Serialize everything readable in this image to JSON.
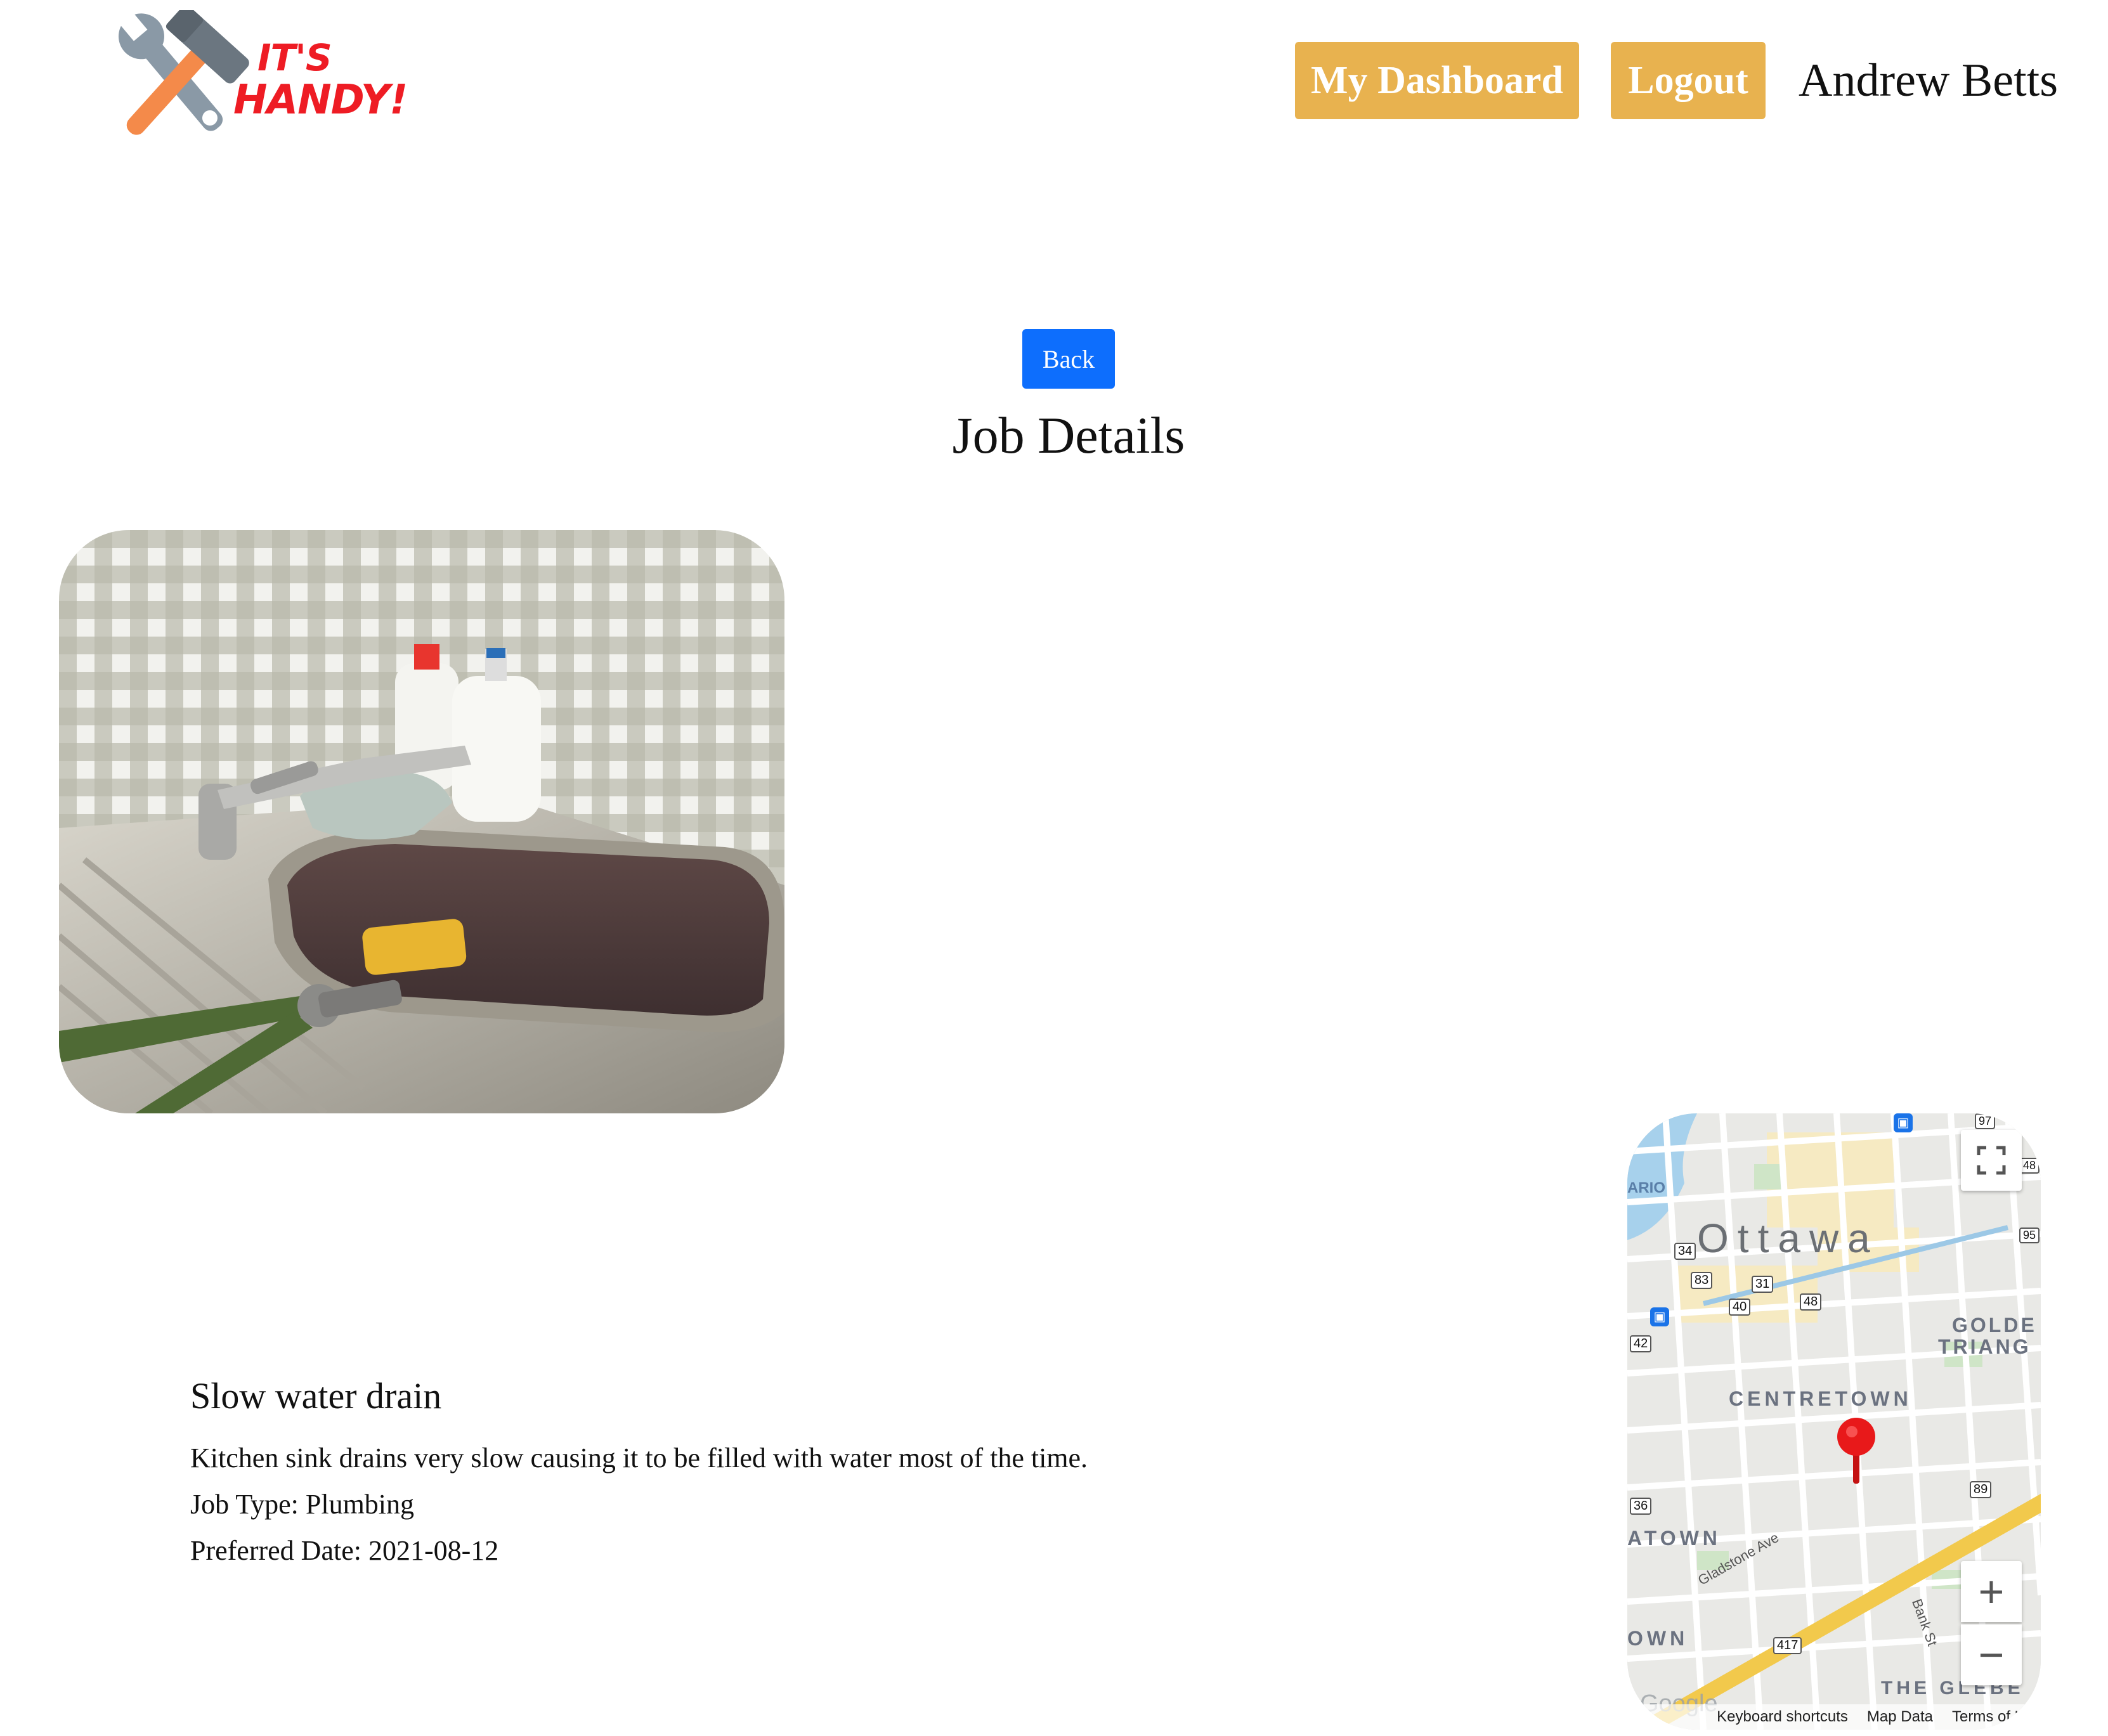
{
  "header": {
    "logo_line1": "IT'S",
    "logo_line2": "HANDY!",
    "dashboard_label": "My Dashboard",
    "logout_label": "Logout",
    "user_name": "Andrew Betts"
  },
  "main": {
    "back_label": "Back",
    "title": "Job Details"
  },
  "job": {
    "title": "Slow water drain",
    "description": "Kitchen sink drains very slow causing it to be filled with water most of the time.",
    "job_type_label": "Job Type:",
    "job_type": "Plumbing",
    "preferred_date_label": "Preferred Date:",
    "preferred_date": "2021-08-12"
  },
  "map": {
    "city": "Ottawa",
    "districts": [
      "CENTRETOWN",
      "GOLDE",
      "TRIANG",
      "ATOWN",
      "OWN",
      "THE GLEBE",
      "ARIO"
    ],
    "streets": [
      "Gladstone Ave",
      "Bank St"
    ],
    "route_badges": [
      "34",
      "83",
      "31",
      "40",
      "48",
      "42",
      "36",
      "89",
      "417",
      "97",
      "48",
      "95"
    ],
    "footer_links": [
      "Keyboard shortcuts",
      "Map Data",
      "Terms of U"
    ],
    "provider": "Google",
    "zoom_in": "+",
    "zoom_out": "−"
  },
  "colors": {
    "accent": "#e8b24f",
    "primary": "#0d6efd",
    "pin": "#e8191a",
    "logo_red": "#ee1c24"
  }
}
